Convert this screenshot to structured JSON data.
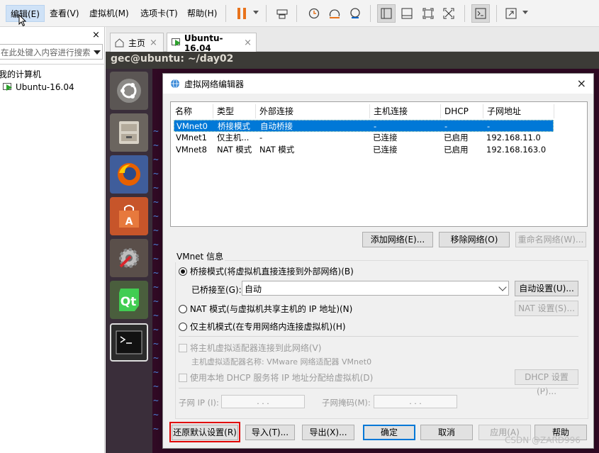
{
  "menu": {
    "items": [
      "编辑(E)",
      "查看(V)",
      "虚拟机(M)",
      "选项卡(T)",
      "帮助(H)"
    ],
    "active_index": 0
  },
  "toolbar": {
    "icons": [
      "pause-icon",
      "send-keys-icon",
      "snapshot-icon",
      "revert-snapshot-icon",
      "manage-snapshots-icon",
      "library-icon",
      "thumbnail-icon",
      "fullscreen-icon",
      "unity-icon",
      "console-icon",
      "stretch-icon"
    ],
    "accent": "#e8731c"
  },
  "library": {
    "close": "×",
    "search_placeholder": "在此处键入内容进行搜索",
    "root": "我的计算机",
    "vm": "Ubuntu-16.04"
  },
  "tabs": [
    {
      "label": "主页",
      "close": "×"
    },
    {
      "label": "Ubuntu-16.04",
      "close": "×"
    }
  ],
  "vm_screen": {
    "title": "gec@ubuntu: ~/day02",
    "tilde": "~"
  },
  "dialog": {
    "title": "虚拟网络编辑器",
    "close": "×",
    "columns": [
      "名称",
      "类型",
      "外部连接",
      "主机连接",
      "DHCP",
      "子网地址"
    ],
    "rows": [
      [
        "VMnet0",
        "桥接模式",
        "自动桥接",
        "-",
        "-",
        "-"
      ],
      [
        "VMnet1",
        "仅主机...",
        "-",
        "已连接",
        "已启用",
        "192.168.11.0"
      ],
      [
        "VMnet8",
        "NAT 模式",
        "NAT 模式",
        "已连接",
        "已启用",
        "192.168.163.0"
      ]
    ],
    "selected_row": 0,
    "add_network": "添加网络(E)...",
    "remove_network": "移除网络(O)",
    "rename_network": "重命名网络(W)...",
    "vmnet_info": "VMnet 信息",
    "bridged_label": "桥接模式(将虚拟机直接连接到外部网络)(B)",
    "bridged_to_label": "已桥接至(G):",
    "bridged_to_value": "自动",
    "auto_settings": "自动设置(U)...",
    "nat_label": "NAT 模式(与虚拟机共享主机的 IP 地址)(N)",
    "nat_settings": "NAT 设置(S)...",
    "host_only_label": "仅主机模式(在专用网络内连接虚拟机)(H)",
    "connect_adapter_label": "将主机虚拟适配器连接到此网络(V)",
    "adapter_name_label": "主机虚拟适配器名称: VMware 网络适配器 VMnet0",
    "dhcp_label": "使用本地 DHCP 服务将 IP 地址分配给虚拟机(D)",
    "dhcp_settings": "DHCP 设置(P)...",
    "subnet_ip_label": "子网 IP (I):",
    "subnet_mask_label": "子网掩码(M):",
    "ip_dots": ".       .       .",
    "restore_defaults": "还原默认设置(R)",
    "import": "导入(T)...",
    "export": "导出(X)...",
    "ok": "确定",
    "cancel": "取消",
    "apply": "应用(A)",
    "help": "帮助"
  },
  "watermark": "CSDN @ZARD996",
  "colors": {
    "selection": "#0078d7",
    "highlight_border": "#e00000",
    "ubuntu_titlebar": "#3c3b37",
    "terminal_bg": "#300a24"
  }
}
